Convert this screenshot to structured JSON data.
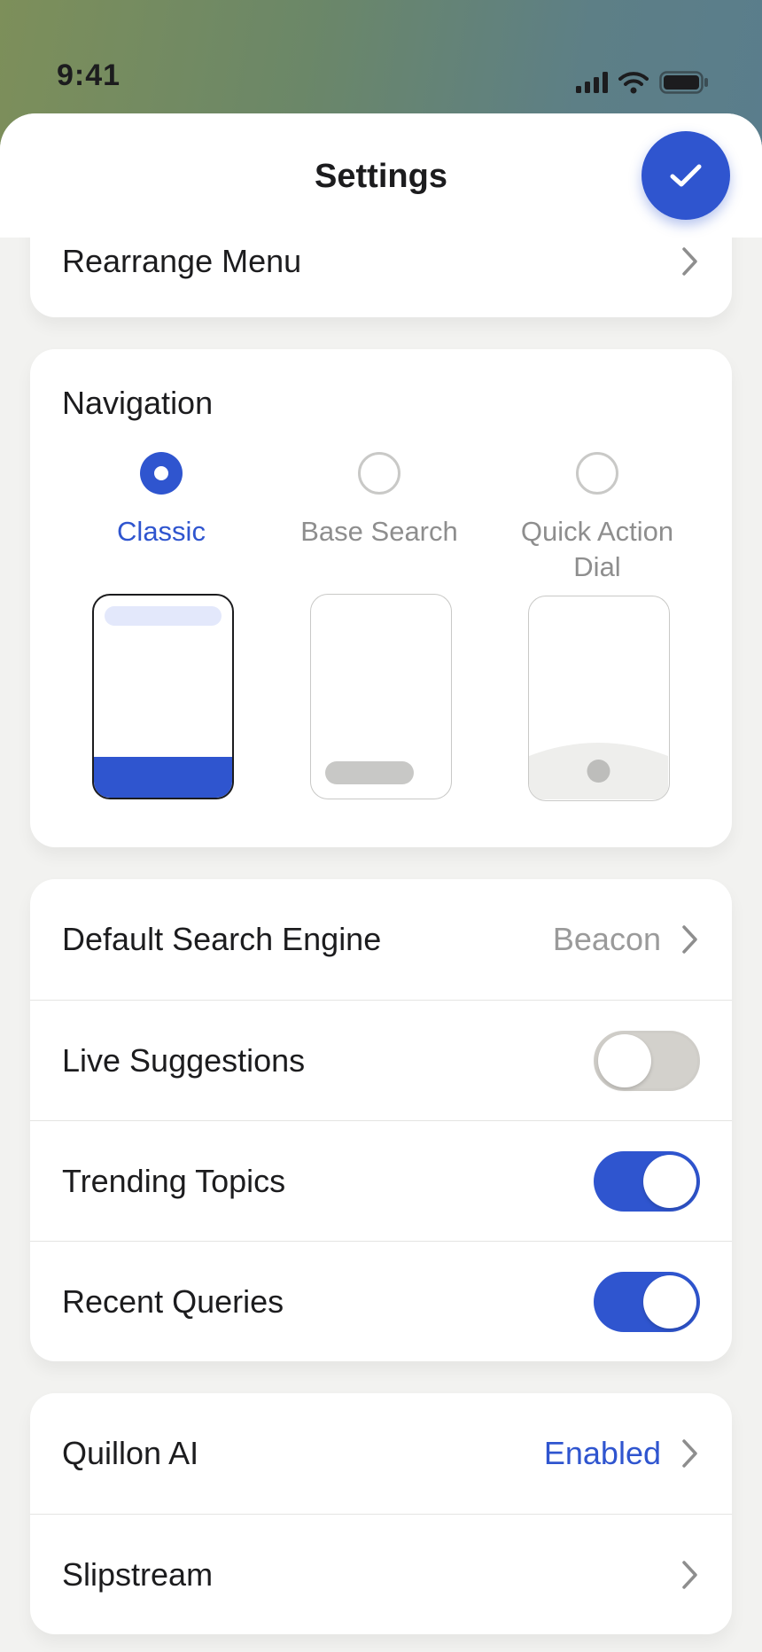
{
  "status_bar": {
    "time": "9:41"
  },
  "header": {
    "title": "Settings"
  },
  "rearrange": {
    "label": "Rearrange Menu"
  },
  "navigation": {
    "title": "Navigation",
    "options": [
      {
        "label": "Classic",
        "selected": true
      },
      {
        "label": "Base Search",
        "selected": false
      },
      {
        "label": "Quick Action Dial",
        "selected": false
      }
    ]
  },
  "search": {
    "default_engine": {
      "label": "Default Search Engine",
      "value": "Beacon"
    },
    "live_suggestions": {
      "label": "Live Suggestions",
      "on": false
    },
    "trending_topics": {
      "label": "Trending Topics",
      "on": true
    },
    "recent_queries": {
      "label": "Recent Queries",
      "on": true
    }
  },
  "extras": {
    "quillon_ai": {
      "label": "Quillon AI",
      "value": "Enabled"
    },
    "slipstream": {
      "label": "Slipstream"
    }
  },
  "colors": {
    "accent": "#2f55cf",
    "background": "#f2f2f0",
    "card": "#ffffff"
  }
}
